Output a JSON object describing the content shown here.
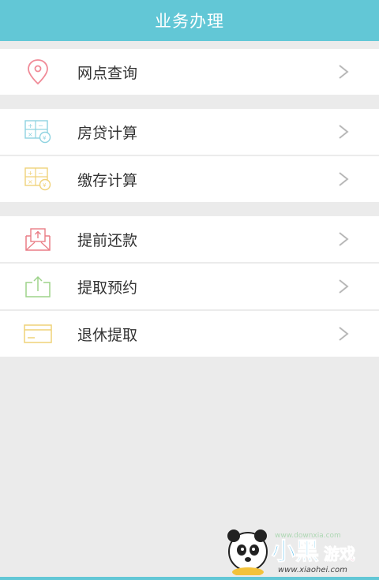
{
  "header": {
    "title": "业务办理"
  },
  "groups": [
    {
      "items": [
        {
          "label": "网点查询",
          "icon": "location-pin-icon"
        }
      ]
    },
    {
      "items": [
        {
          "label": "房贷计算",
          "icon": "calculator-icon"
        },
        {
          "label": "缴存计算",
          "icon": "calculator-icon"
        }
      ]
    },
    {
      "items": [
        {
          "label": "提前还款",
          "icon": "envelope-upload-icon"
        },
        {
          "label": "提取预约",
          "icon": "upload-tray-icon"
        },
        {
          "label": "退休提取",
          "icon": "card-icon"
        }
      ]
    }
  ],
  "colors": {
    "header_bg": "#62c7d6",
    "pin": "#f08a97",
    "calc_blue": "#8fd3e0",
    "calc_yellow": "#f0d27a",
    "envelope_red": "#ea7d86",
    "upload_green": "#9dd38a",
    "card_yellow": "#efd278"
  },
  "watermark": {
    "brand": "小黑游戏",
    "url": "www.xiaohei.com"
  }
}
